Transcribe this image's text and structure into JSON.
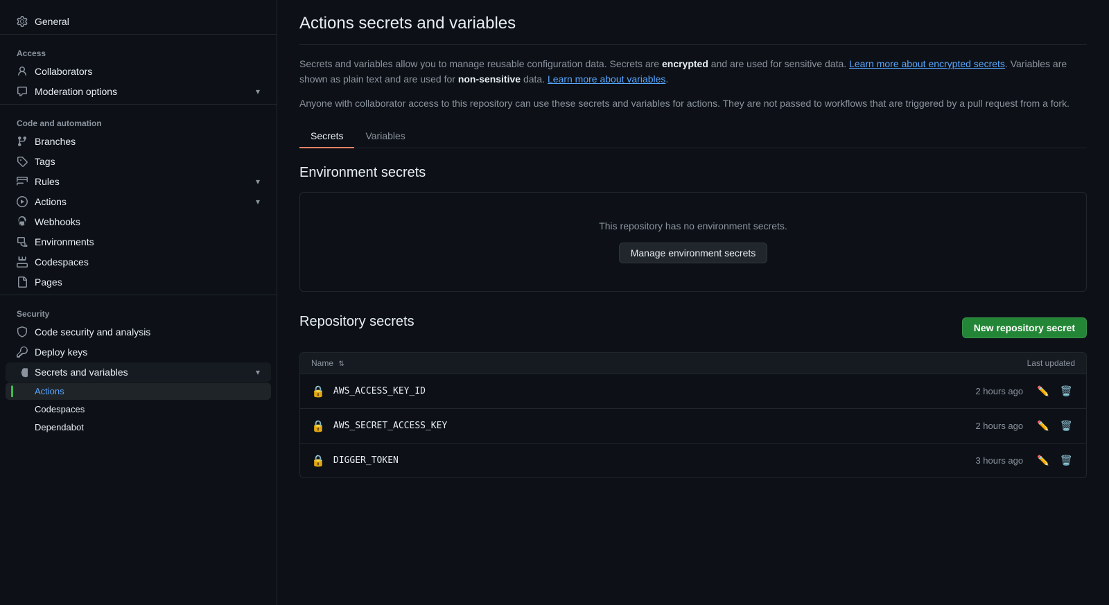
{
  "sidebar": {
    "top_item": {
      "label": "General",
      "icon": "gear"
    },
    "sections": [
      {
        "label": "Access",
        "items": [
          {
            "id": "collaborators",
            "label": "Collaborators",
            "icon": "person",
            "hasChevron": false
          },
          {
            "id": "moderation",
            "label": "Moderation options",
            "icon": "comment",
            "hasChevron": true
          }
        ]
      },
      {
        "label": "Code and automation",
        "items": [
          {
            "id": "branches",
            "label": "Branches",
            "icon": "branches",
            "hasChevron": false
          },
          {
            "id": "tags",
            "label": "Tags",
            "icon": "tag",
            "hasChevron": false
          },
          {
            "id": "rules",
            "label": "Rules",
            "icon": "rules",
            "hasChevron": true
          },
          {
            "id": "actions",
            "label": "Actions",
            "icon": "actions",
            "hasChevron": true
          },
          {
            "id": "webhooks",
            "label": "Webhooks",
            "icon": "webhook",
            "hasChevron": false
          },
          {
            "id": "environments",
            "label": "Environments",
            "icon": "environment",
            "hasChevron": false
          },
          {
            "id": "codespaces",
            "label": "Codespaces",
            "icon": "codespaces",
            "hasChevron": false
          },
          {
            "id": "pages",
            "label": "Pages",
            "icon": "pages",
            "hasChevron": false
          }
        ]
      },
      {
        "label": "Security",
        "items": [
          {
            "id": "codesecurity",
            "label": "Code security and analysis",
            "icon": "shield",
            "hasChevron": false
          },
          {
            "id": "deploykeys",
            "label": "Deploy keys",
            "icon": "key",
            "hasChevron": false
          },
          {
            "id": "secrets",
            "label": "Secrets and variables",
            "icon": "secret",
            "hasChevron": true,
            "active": true
          }
        ]
      }
    ],
    "sub_items": [
      {
        "id": "actions-sub",
        "label": "Actions",
        "active": true
      },
      {
        "id": "codespaces-sub",
        "label": "Codespaces"
      },
      {
        "id": "dependabot-sub",
        "label": "Dependabot"
      }
    ]
  },
  "main": {
    "title": "Actions secrets and variables",
    "description1": "Secrets and variables allow you to manage reusable configuration data. Secrets are ",
    "bold1": "encrypted",
    "description1b": " and are used for sensitive data. ",
    "link1": "Learn more about encrypted secrets",
    "description1c": ". Variables are shown as plain text and are used for ",
    "bold2": "non-sensitive",
    "description1d": " data. ",
    "link2": "Learn more about variables",
    "description1e": ".",
    "description2": "Anyone with collaborator access to this repository can use these secrets and variables for actions. They are not passed to workflows that are triggered by a pull request from a fork.",
    "tabs": [
      {
        "id": "secrets",
        "label": "Secrets",
        "active": true
      },
      {
        "id": "variables",
        "label": "Variables",
        "active": false
      }
    ],
    "env_secrets": {
      "section_title": "Environment secrets",
      "empty_message": "This repository has no environment secrets.",
      "manage_btn": "Manage environment secrets"
    },
    "repo_secrets": {
      "section_title": "Repository secrets",
      "new_btn": "New repository secret",
      "table_header_name": "Name",
      "table_header_updated": "Last updated",
      "rows": [
        {
          "name": "AWS_ACCESS_KEY_ID",
          "updated": "2 hours ago"
        },
        {
          "name": "AWS_SECRET_ACCESS_KEY",
          "updated": "2 hours ago"
        },
        {
          "name": "DIGGER_TOKEN",
          "updated": "3 hours ago"
        }
      ]
    }
  }
}
